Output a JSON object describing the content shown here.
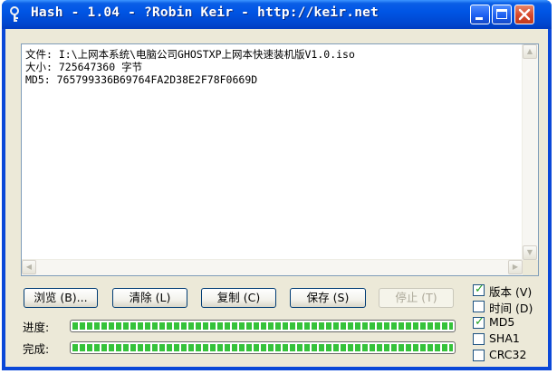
{
  "window": {
    "title": "Hash - 1.04 - ?Robin Keir - http://keir.net"
  },
  "output": {
    "lines": [
      "文件: I:\\上网本系统\\电脑公司GHOSTXP上网本快速装机版V1.0.iso",
      "大小: 725647360 字节",
      "MD5: 765799336B69764FA2D38E2F78F0669D"
    ]
  },
  "buttons": {
    "browse": "浏览 (B)...",
    "clear": "清除 (L)",
    "copy": "复制 (C)",
    "save": "保存 (S)",
    "stop": "停止 (T)"
  },
  "progress": {
    "current_label": "进度:",
    "current_value": 1.0,
    "total_label": "完成:",
    "total_value": 1.0
  },
  "options": [
    {
      "label": "版本 (V)",
      "checked": true
    },
    {
      "label": "时间 (D)",
      "checked": false
    },
    {
      "label": "MD5",
      "checked": true
    },
    {
      "label": "SHA1",
      "checked": false
    },
    {
      "label": "CRC32",
      "checked": false
    }
  ],
  "colors": {
    "title_bar": "#0055e5",
    "progress_fill": "#35c23a",
    "check_mark": "#21a121",
    "close_button": "#d6472a"
  }
}
